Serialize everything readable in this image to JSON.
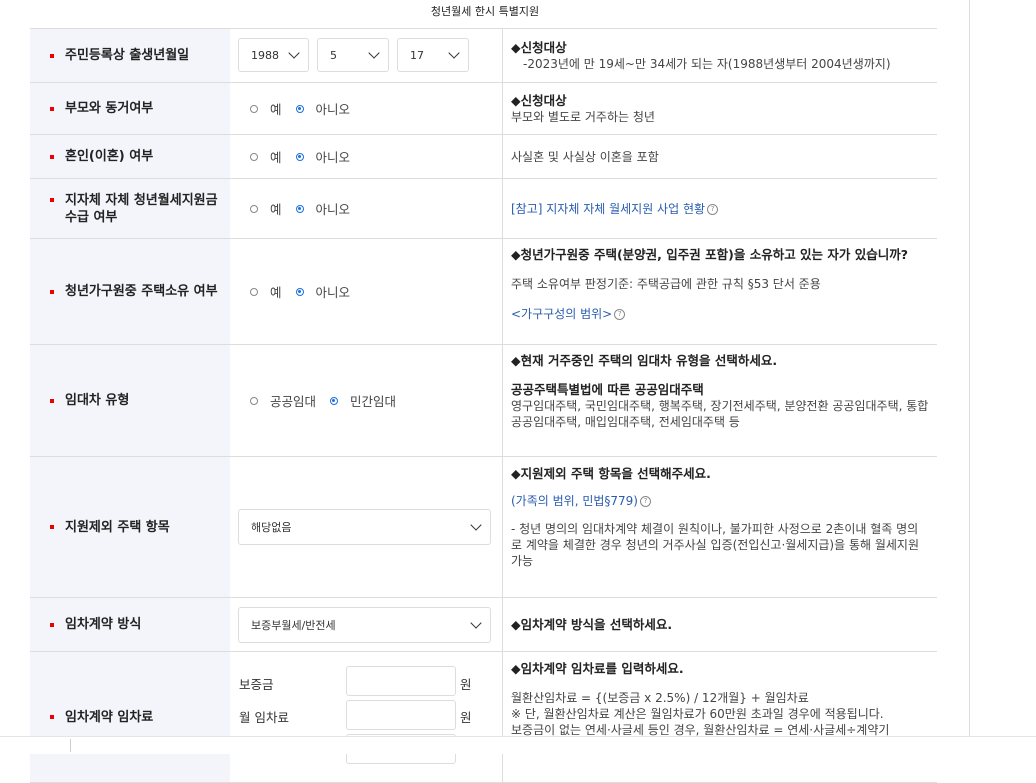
{
  "page_title": "청년월세 한시 특별지원",
  "rows": {
    "birth": {
      "label": "주민등록상 출생년월일",
      "year": "1988",
      "month": "5",
      "day": "17",
      "info_title": "◆신청대상",
      "info_text": "-2023년에 만 19세~만 34세가 되는 자(1988년생부터 2004년생까지)"
    },
    "parents": {
      "label": "부모와 동거여부",
      "opt_yes": "예",
      "opt_no": "아니오",
      "info_title": "◆신청대상",
      "info_text": "부모와 별도로 거주하는 청년"
    },
    "marriage": {
      "label": "혼인(이혼) 여부",
      "opt_yes": "예",
      "opt_no": "아니오",
      "info_text": "사실혼 및 사실상 이혼을 포함"
    },
    "local_support": {
      "label_line1": "지자체 자체 청년월세지원금",
      "label_line2": "수급 여부",
      "opt_yes": "예",
      "opt_no": "아니오",
      "info_link": "[참고] 지자체 자체 월세지원 사업 현황"
    },
    "house": {
      "label": "청년가구원중 주택소유 여부",
      "opt_yes": "예",
      "opt_no": "아니오",
      "info_title": "◆청년가구원중 주택(분양권, 입주권 포함)을 소유하고 있는 자가 있습니까?",
      "info_text": "주택 소유여부 판정기준: 주택공급에 관한 규칙 §53 단서 준용",
      "info_link": "<가구구성의 범위>"
    },
    "lessor": {
      "label": "임대차 유형",
      "opt_public": "공공임대",
      "opt_private": "민간임대",
      "info_title": "◆현재 거주중인 주택의 임대차 유형을 선택하세요.",
      "info_sub": "공공주택특별법에 따른 공공임대주택",
      "info_text": "영구임대주택, 국민임대주택, 행복주택, 장기전세주택, 분양전환 공공임대주택, 통합공공임대주택, 매입임대주택, 전세임대주택 등"
    },
    "exclude": {
      "label": "지원제외 주택 항목",
      "select_value": "해당없음",
      "info_title": "◆지원제외 주택 항목을 선택해주세요.",
      "info_link": "(가족의 범위, 민법§779)",
      "info_text": "- 청년 명의의 임대차계약 체결이 원칙이나, 불가피한 사정으로 2촌이내 혈족 명의로 계약을 체결한 경우 청년의 거주사실 입증(전입신고·월세지급)을 통해 월세지원 가능"
    },
    "contract": {
      "label": "임차계약 방식",
      "select_value": "보증부월세/반전세",
      "info_title": "◆임차계약 방식을 선택하세요."
    },
    "rent": {
      "label": "임차계약 임차료",
      "deposit_label": "보증금",
      "monthly_label": "월 임차료",
      "unit": "원",
      "info_title": "◆임차계약 임차료를 입력하세요.",
      "info_line1": "월환산임차료 = {(보증금 x 2.5%) / 12개월} + 월임차료",
      "info_line2": "※ 단, 월환산임차료 계산은 월임차료가 60만원 초과일 경우에 적용됩니다.",
      "info_line3": "보증금이 없는 연세·사글세 등인 경우, 월환산임차료 = 연세·사글세÷계약기"
    }
  }
}
